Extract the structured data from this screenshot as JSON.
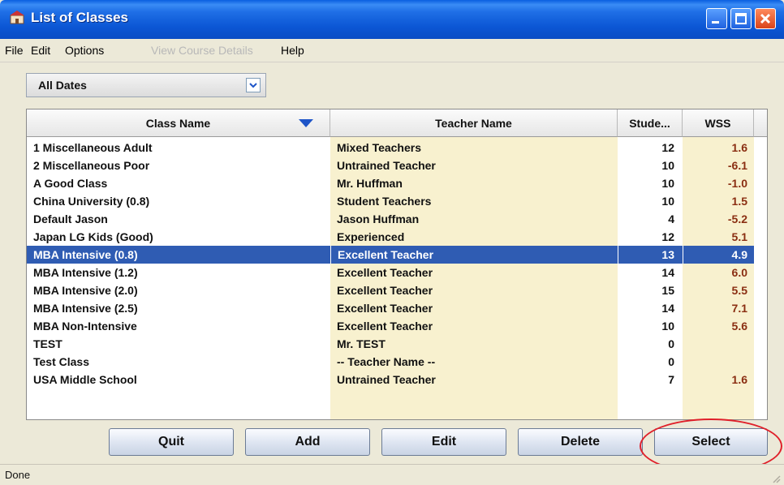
{
  "window": {
    "title": "List of Classes"
  },
  "menu": [
    {
      "label": "File",
      "enabled": true
    },
    {
      "label": "Edit",
      "enabled": true
    },
    {
      "label": "Options",
      "enabled": true
    },
    {
      "label": "View Course Details",
      "enabled": false
    },
    {
      "label": "Help",
      "enabled": true
    }
  ],
  "date_filter": {
    "selected": "All Dates"
  },
  "table": {
    "columns": [
      "Class Name",
      "Teacher Name",
      "Stude...",
      "WSS"
    ],
    "sort_column": "Class Name",
    "sort_direction": "descending",
    "rows": [
      {
        "class_name": "1 Miscellaneous Adult",
        "teacher": "Mixed Teachers",
        "students": "12",
        "wss": "1.6"
      },
      {
        "class_name": "2 Miscellaneous Poor",
        "teacher": "Untrained Teacher",
        "students": "10",
        "wss": "-6.1"
      },
      {
        "class_name": "A Good Class",
        "teacher": "Mr. Huffman",
        "students": "10",
        "wss": "-1.0"
      },
      {
        "class_name": "China University (0.8)",
        "teacher": "Student Teachers",
        "students": "10",
        "wss": "1.5"
      },
      {
        "class_name": "Default Jason",
        "teacher": "Jason Huffman",
        "students": "4",
        "wss": "-5.2"
      },
      {
        "class_name": "Japan LG Kids (Good)",
        "teacher": "Experienced",
        "students": "12",
        "wss": "5.1"
      },
      {
        "class_name": "MBA Intensive (0.8)",
        "teacher": "Excellent Teacher",
        "students": "13",
        "wss": "4.9",
        "selected": true
      },
      {
        "class_name": "MBA Intensive (1.2)",
        "teacher": "Excellent Teacher",
        "students": "14",
        "wss": "6.0"
      },
      {
        "class_name": "MBA Intensive (2.0)",
        "teacher": "Excellent Teacher",
        "students": "15",
        "wss": "5.5"
      },
      {
        "class_name": "MBA Intensive (2.5)",
        "teacher": "Excellent Teacher",
        "students": "14",
        "wss": "7.1"
      },
      {
        "class_name": "MBA Non-Intensive",
        "teacher": "Excellent Teacher",
        "students": "10",
        "wss": "5.6"
      },
      {
        "class_name": "TEST",
        "teacher": "Mr. TEST",
        "students": "0",
        "wss": ""
      },
      {
        "class_name": "Test Class",
        "teacher": "-- Teacher Name --",
        "students": "0",
        "wss": ""
      },
      {
        "class_name": "USA Middle School",
        "teacher": "Untrained Teacher",
        "students": "7",
        "wss": "1.6"
      }
    ]
  },
  "buttons": {
    "quit": "Quit",
    "add": "Add",
    "edit": "Edit",
    "delete": "Delete",
    "select": "Select"
  },
  "status": {
    "text": "Done"
  },
  "colors": {
    "title_bar": "#0b56d4",
    "selection": "#2f5cb3",
    "teacher_column_bg": "#f8f1cf",
    "wss_text": "#8a2e12",
    "annotation_ring": "#e0202a"
  }
}
